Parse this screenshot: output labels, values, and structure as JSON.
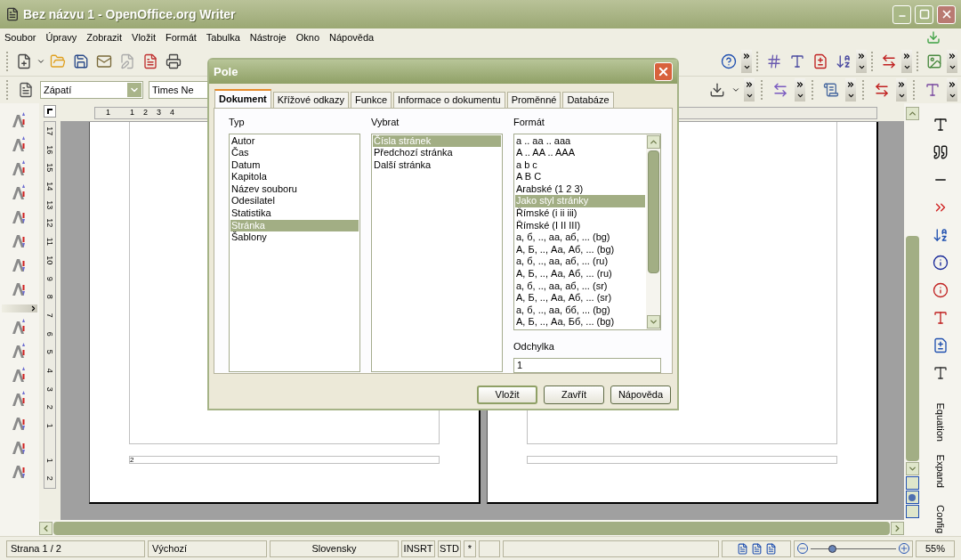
{
  "window": {
    "title": "Bez názvu 1 - OpenOffice.org Writer"
  },
  "menu": [
    "Soubor",
    "Úpravy",
    "Zobrazit",
    "Vložit",
    "Formát",
    "Tabulka",
    "Nástroje",
    "Okno",
    "Nápověda"
  ],
  "formatting": {
    "paragraph_style": "Zápatí",
    "font_name": "Times Ne"
  },
  "ruler": {
    "horizontal": [
      "1",
      "1",
      "2",
      "3",
      "4"
    ],
    "vertical": [
      "17",
      "16",
      "15",
      "14",
      "13",
      "12",
      "11",
      "10",
      "9",
      "8",
      "7",
      "6",
      "5",
      "4",
      "3",
      "2",
      "1",
      "1",
      "2"
    ]
  },
  "document": {
    "footer_text": "2"
  },
  "side_panel": {
    "labels": [
      "Equation",
      "Expand",
      "Config"
    ]
  },
  "dialog": {
    "title": "Pole",
    "tabs": [
      {
        "label": "Dokument",
        "selected": true
      },
      {
        "label": "Křížové odkazy",
        "selected": false
      },
      {
        "label": "Funkce",
        "selected": false
      },
      {
        "label": "Informace o dokumentu",
        "selected": false
      },
      {
        "label": "Proměnné",
        "selected": false
      },
      {
        "label": "Databáze",
        "selected": false
      }
    ],
    "columns": [
      {
        "label": "Typ",
        "items": [
          {
            "text": "Autor",
            "selected": false
          },
          {
            "text": "Čas",
            "selected": false
          },
          {
            "text": "Datum",
            "selected": false
          },
          {
            "text": "Kapitola",
            "selected": false
          },
          {
            "text": "Název souboru",
            "selected": false
          },
          {
            "text": "Odesilatel",
            "selected": false
          },
          {
            "text": "Statistika",
            "selected": false
          },
          {
            "text": "Stránka",
            "selected": true
          },
          {
            "text": "Šablony",
            "selected": false
          }
        ]
      },
      {
        "label": "Vybrat",
        "items": [
          {
            "text": "Čísla stránek",
            "selected": true
          },
          {
            "text": "Předchozí stránka",
            "selected": false
          },
          {
            "text": "Další stránka",
            "selected": false
          }
        ]
      },
      {
        "label": "Formát",
        "items": [
          {
            "text": "a .. aa .. aaa",
            "selected": false
          },
          {
            "text": "A .. AA .. AAA",
            "selected": false
          },
          {
            "text": "a b c",
            "selected": false
          },
          {
            "text": "A B C",
            "selected": false
          },
          {
            "text": "Arabské (1 2 3)",
            "selected": false
          },
          {
            "text": "Jako styl stránky",
            "selected": true
          },
          {
            "text": "Římské (i ii iii)",
            "selected": false
          },
          {
            "text": "Římské (I II III)",
            "selected": false
          },
          {
            "text": "а, б, .., аа, аб, ... (bg)",
            "selected": false
          },
          {
            "text": "А, Б, .., Аа, Аб, ... (bg)",
            "selected": false
          },
          {
            "text": "а, б, .., аа, аб, ... (ru)",
            "selected": false
          },
          {
            "text": "А, Б, .., Аа, Аб, ... (ru)",
            "selected": false
          },
          {
            "text": "а, б, .., аа, аб, ... (sr)",
            "selected": false
          },
          {
            "text": "А, Б, .., Аа, Аб, ... (sr)",
            "selected": false
          },
          {
            "text": "а, б, .., аа, бб, ... (bg)",
            "selected": false
          },
          {
            "text": "А, Б, .., Аа, Бб, ... (bg)",
            "selected": false
          }
        ]
      }
    ],
    "offset": {
      "label": "Odchylka",
      "value": "1"
    },
    "buttons": [
      {
        "label": "Vložit",
        "default": true
      },
      {
        "label": "Zavřít",
        "default": false
      },
      {
        "label": "Nápověda",
        "default": false
      }
    ]
  },
  "status_bar": {
    "page": "Strana 1 / 2",
    "page_style": "Výchozí",
    "language": "Slovensky",
    "insert_mode": "INSRT",
    "selection_mode": "STD",
    "modified": "*",
    "zoom_slider": {
      "level": 0.25
    },
    "zoom": "55%"
  }
}
